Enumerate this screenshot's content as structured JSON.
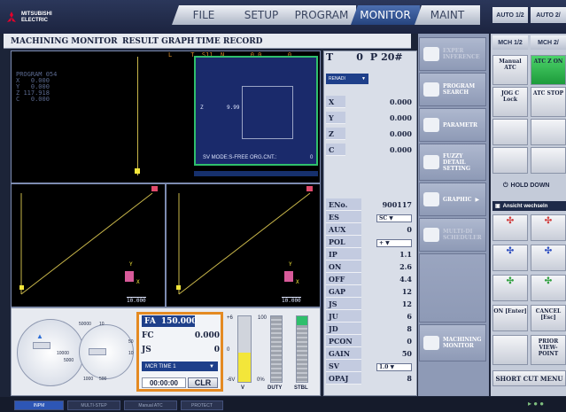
{
  "brand": {
    "line1": "MITSUBISHI",
    "line2": "ELECTRIC"
  },
  "top_tabs": [
    "FILE",
    "SETUP",
    "PROGRAM",
    "MONITOR",
    "MAINT"
  ],
  "active_tab": "MONITOR",
  "small_tabs": [
    "AUTO 1/2",
    "AUTO 2/"
  ],
  "subtabs": [
    "MACHINING MONITOR",
    "RESULT GRAPH",
    "TIME RECORD"
  ],
  "plot_top": {
    "header": "L     T  S11  N       0.0       0",
    "program": "PROGRAM  054",
    "axes": [
      {
        "l": "X",
        "v": "0.000"
      },
      {
        "l": "Y",
        "v": "0.000"
      },
      {
        "l": "Z",
        "v": "117.918"
      },
      {
        "l": "C",
        "v": "0.000"
      }
    ],
    "z_label": "Z",
    "z_value": "9.99",
    "sv_mode": "SV MODE:S-FREE  ORG.CNT.:",
    "sv_count": "0"
  },
  "plot_bottom": {
    "left_scale": "10.000",
    "right_scale": "10.000",
    "y": "Y",
    "x": "X"
  },
  "dial": {
    "top": "50000",
    "mid": "10",
    "left1": "10000",
    "left2": "5000",
    "right": "50",
    "bot1": "1000",
    "bot2": "500",
    "r2": "10"
  },
  "feed_box": {
    "fa_label": "FA",
    "fa_value": "150.000",
    "fc_label": "FC",
    "fc_value": "0.000",
    "js_label": "JS",
    "js_value": "0",
    "select": "MCR TIME 1",
    "time": "00:00:00",
    "clr": "CLR"
  },
  "meters": {
    "p6": "+6",
    "m6": "-6V",
    "zero": "0",
    "h100": "100",
    "p0": "0%",
    "v": "V",
    "duty": "DUTY",
    "stbl": "STBL",
    "level_v": 0.45
  },
  "tpos": {
    "t_label": "T",
    "t_value": "0",
    "p_label": "P",
    "p_value": "20#",
    "mode": "RENADI"
  },
  "axes_right": [
    {
      "l": "X",
      "v": "0.000"
    },
    {
      "l": "Y",
      "v": "0.000"
    },
    {
      "l": "Z",
      "v": "0.000"
    },
    {
      "l": "C",
      "v": "0.000"
    }
  ],
  "params": [
    {
      "l": "ENo.",
      "v": "900117"
    },
    {
      "l": "ES",
      "v": "SC"
    },
    {
      "l": "AUX",
      "v": "0"
    },
    {
      "l": "POL",
      "v": "+"
    },
    {
      "l": "IP",
      "v": "1.1"
    },
    {
      "l": "ON",
      "v": "2.6"
    },
    {
      "l": "OFF",
      "v": "4.4"
    },
    {
      "l": "GAP",
      "v": "12"
    },
    {
      "l": "JS",
      "v": "12"
    },
    {
      "l": "JU",
      "v": "6"
    },
    {
      "l": "JD",
      "v": "8"
    },
    {
      "l": "PCON",
      "v": "0"
    },
    {
      "l": "GAIN",
      "v": "50"
    },
    {
      "l": "SV",
      "v": "1.0"
    },
    {
      "l": "OPAJ",
      "v": "8"
    }
  ],
  "side_buttons": [
    {
      "l": "EXPER INFERENCE",
      "dis": true
    },
    {
      "l": "PROGRAM SEARCH",
      "dis": false
    },
    {
      "l": "PARAMETR",
      "dis": false
    },
    {
      "l": "FUZZY DETAIL SETTING",
      "dis": false
    },
    {
      "l": "GRAPHIC",
      "dis": false
    },
    {
      "l": "MULTI-DI SCHEDULER",
      "dis": true
    },
    {
      "l": "MACHINING MONITOR",
      "dis": false
    }
  ],
  "right_tabs": [
    "MCH 1/2",
    "MCH 2/"
  ],
  "right_buttons": [
    "Manual ATC",
    "ATC Z ON",
    "JOG C Lock",
    "ATC STOP"
  ],
  "hold_label": "HOLD DOWN",
  "ansicht": "Ansicht wechseln",
  "on_enter": "ON [Enter]",
  "cancel": "CANCEL [Esc]",
  "prior_view": "PRIOR VIEW-POINT",
  "shortcut": "SHORT CUT MENU",
  "status": [
    "INPM",
    "MULTI-STEP",
    "Manual ATC",
    "PROTECT"
  ]
}
